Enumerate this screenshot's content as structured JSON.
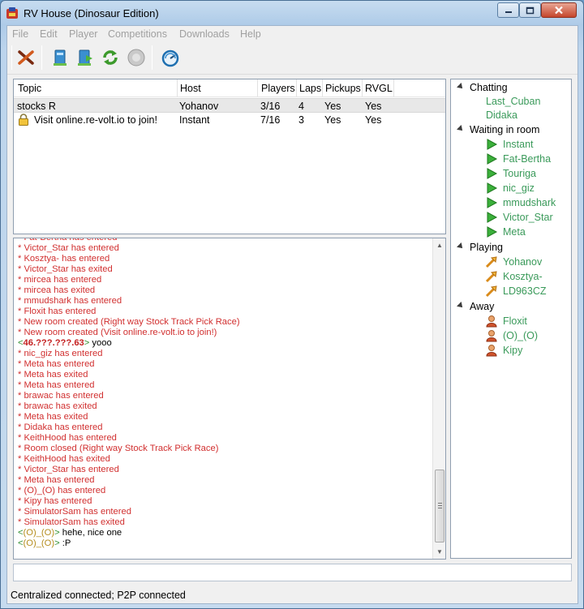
{
  "window": {
    "title": "RV House (Dinosaur Edition)"
  },
  "menu": [
    "File",
    "Edit",
    "Player",
    "Competitions",
    "Downloads",
    "Help"
  ],
  "toolbar": [
    "disconnect-icon",
    "host-room-icon",
    "join-room-icon",
    "refresh-icon",
    "stop-icon",
    "speedometer-icon"
  ],
  "rooms": {
    "columns": [
      "Topic",
      "Host",
      "Players",
      "Laps",
      "Pickups",
      "RVGL"
    ],
    "rows": [
      {
        "locked": false,
        "topic": "stocks R",
        "host": "Yohanov",
        "players": "3/16",
        "laps": "4",
        "pickups": "Yes",
        "rvgl": "Yes"
      },
      {
        "locked": true,
        "topic": "Visit online.re-volt.io to join!",
        "host": "Instant",
        "players": "7/16",
        "laps": "3",
        "pickups": "Yes",
        "rvgl": "Yes"
      }
    ]
  },
  "chat": [
    {
      "type": "sys",
      "text": "* Fat-Bertha has entered"
    },
    {
      "type": "sys",
      "text": "* Victor_Star has entered"
    },
    {
      "type": "sys",
      "text": "* Kosztya- has entered"
    },
    {
      "type": "sys",
      "text": "* Victor_Star has exited"
    },
    {
      "type": "sys",
      "text": "* mircea has entered"
    },
    {
      "type": "sys",
      "text": "* mircea has exited"
    },
    {
      "type": "sys",
      "text": "* mmudshark has entered"
    },
    {
      "type": "sys",
      "text": "* Floxit has entered"
    },
    {
      "type": "sys",
      "text": "* New room created (Right way Stock Track Pick Race)"
    },
    {
      "type": "sys",
      "text": "* New room created (Visit online.re-volt.io to join!)"
    },
    {
      "type": "msg",
      "nick": "46.???.???.63",
      "ip": true,
      "text": " yooo"
    },
    {
      "type": "sys",
      "text": "* nic_giz has entered"
    },
    {
      "type": "sys",
      "text": "* Meta has entered"
    },
    {
      "type": "sys",
      "text": "* Meta has exited"
    },
    {
      "type": "sys",
      "text": "* Meta has entered"
    },
    {
      "type": "sys",
      "text": "* brawac has entered"
    },
    {
      "type": "sys",
      "text": "* brawac has exited"
    },
    {
      "type": "sys",
      "text": "* Meta has exited"
    },
    {
      "type": "sys",
      "text": "* Didaka has entered"
    },
    {
      "type": "sys",
      "text": "* KeithHood has entered"
    },
    {
      "type": "sys",
      "text": "* Room closed (Right way Stock Track Pick Race)"
    },
    {
      "type": "sys",
      "text": "* KeithHood has exited"
    },
    {
      "type": "sys",
      "text": "* Victor_Star has entered"
    },
    {
      "type": "sys",
      "text": "* Meta has entered"
    },
    {
      "type": "sys",
      "text": "* (O)_(O) has entered"
    },
    {
      "type": "sys",
      "text": "* Kipy has entered"
    },
    {
      "type": "sys",
      "text": "* SimulatorSam has entered"
    },
    {
      "type": "sys",
      "text": "* SimulatorSam has exited"
    },
    {
      "type": "msg",
      "nick": "(O)_(O)",
      "ip": false,
      "text": " hehe, nice one"
    },
    {
      "type": "msg",
      "nick": "(O)_(O)",
      "ip": false,
      "text": " :P"
    }
  ],
  "players": [
    {
      "group": "Chatting",
      "icon": "none",
      "members": [
        "Last_Cuban",
        "Didaka"
      ]
    },
    {
      "group": "Waiting in room",
      "icon": "play-flag-icon",
      "members": [
        "Instant",
        "Fat-Bertha",
        "Touriga",
        "nic_giz",
        "mmudshark",
        "Victor_Star",
        "Meta"
      ]
    },
    {
      "group": "Playing",
      "icon": "racing-arrow-icon",
      "members": [
        "Yohanov",
        "Kosztya-",
        "LD963CZ"
      ]
    },
    {
      "group": "Away",
      "icon": "away-user-icon",
      "members": [
        "Floxit",
        "(O)_(O)",
        "Kipy"
      ]
    }
  ],
  "status": "Centralized connected; P2P connected",
  "colors": {
    "system": "#d12f2f",
    "nick_bracket": "#2f8f2f",
    "nick_name": "#b58d1e",
    "player_name": "#3a9a5a"
  }
}
